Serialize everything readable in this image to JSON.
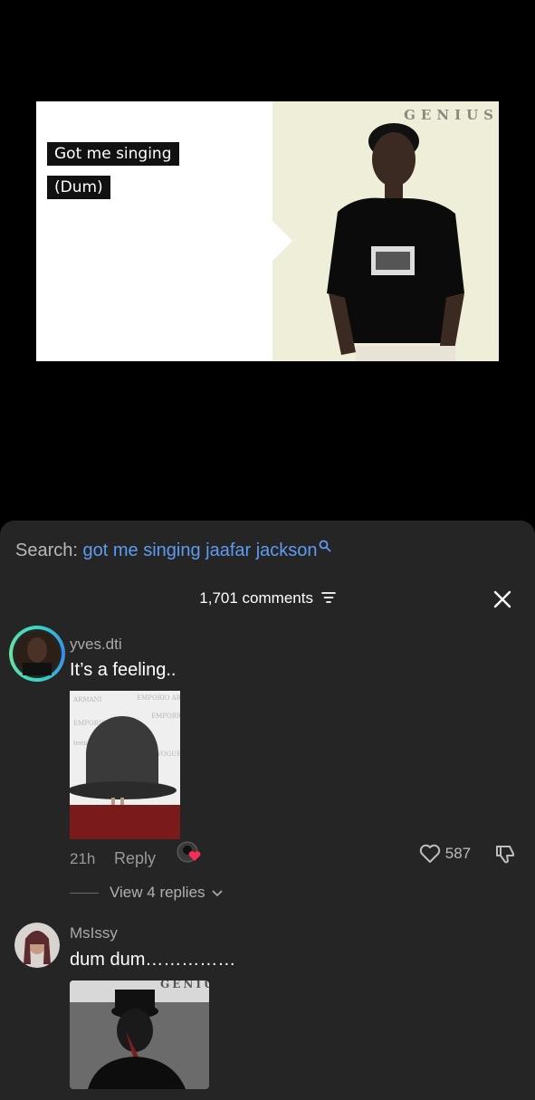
{
  "video": {
    "caption_line1": "Got me singing",
    "caption_line2": "(Dum)",
    "watermark": "GENIUS"
  },
  "search": {
    "label": "Search:",
    "query": "got me singing jaafar jackson"
  },
  "comments_header": {
    "count_label": "1,701 comments"
  },
  "comments": [
    {
      "username": "yves.dti",
      "text": "It’s a feeling..",
      "time": "21h",
      "reply_label": "Reply",
      "likes": "587",
      "view_replies": "View 4 replies"
    },
    {
      "username": "MsIssy",
      "text": "dum dum……………",
      "image_watermark": "GENIU"
    }
  ],
  "colors": {
    "sheet_bg": "#252525",
    "link_blue": "#5e9bf2",
    "like_heart": "#fe2c55"
  }
}
